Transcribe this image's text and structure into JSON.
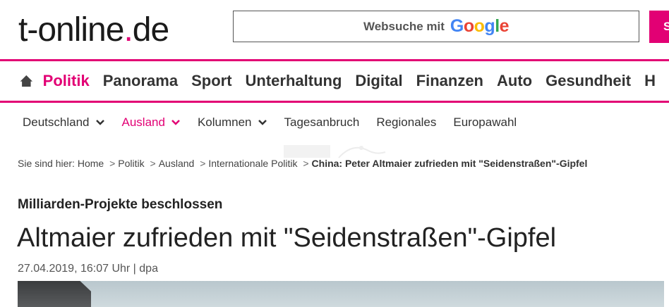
{
  "header": {
    "logo_main": "t-online",
    "logo_dot": ".",
    "logo_tld": "de",
    "search_label": "Websuche mit",
    "search_brand": [
      "G",
      "o",
      "o",
      "g",
      "l",
      "e"
    ],
    "search_button_label": "S"
  },
  "colors": {
    "brand": "#e20074",
    "text": "#222222"
  },
  "main_nav": {
    "home_icon": "home-icon",
    "items": [
      "Politik",
      "Panorama",
      "Sport",
      "Unterhaltung",
      "Digital",
      "Finanzen",
      "Auto",
      "Gesundheit",
      "H"
    ],
    "active": "Politik"
  },
  "sub_nav": {
    "items": [
      "Deutschland",
      "Ausland",
      "Kolumnen",
      "Tagesanbruch",
      "Regionales",
      "Europawahl"
    ],
    "active": "Ausland"
  },
  "breadcrumb": {
    "prefix": "Sie sind hier:",
    "items": [
      "Home",
      "Politik",
      "Ausland",
      "Internationale Politik"
    ],
    "separator": ">",
    "current": "China: Peter Altmaier zufrieden mit \"Seidenstraßen\"-Gipfel"
  },
  "article": {
    "kicker": "Milliarden-Projekte beschlossen",
    "headline": "Altmaier zufrieden mit \"Seidenstraßen\"-Gipfel",
    "meta": "27.04.2019, 16:07 Uhr | dpa"
  }
}
